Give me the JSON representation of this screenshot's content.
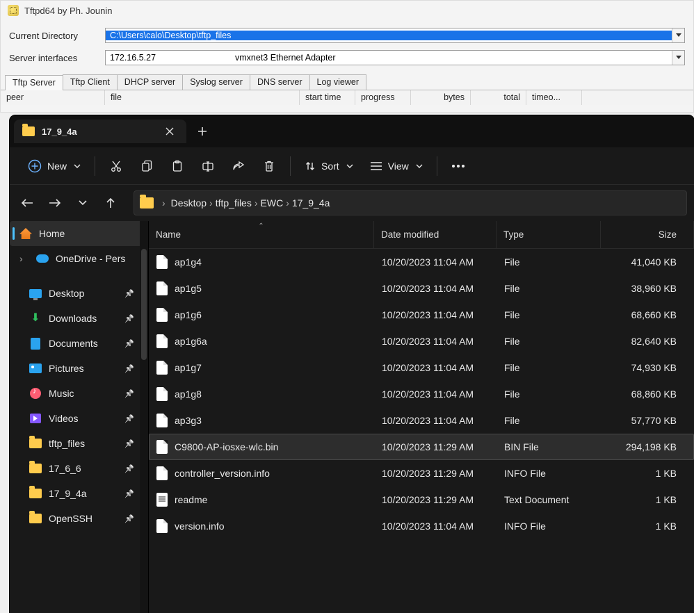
{
  "tftpd": {
    "title": "Tftpd64 by Ph. Jounin",
    "labels": {
      "current_dir": "Current Directory",
      "server_if": "Server interfaces"
    },
    "current_directory": "C:\\Users\\calo\\Desktop\\tftp_files",
    "server_interface_ip": "172.16.5.27",
    "server_interface_adapter": "vmxnet3 Ethernet Adapter",
    "tabs": [
      "Tftp Server",
      "Tftp Client",
      "DHCP server",
      "Syslog server",
      "DNS server",
      "Log viewer"
    ],
    "columns": [
      "peer",
      "file",
      "start time",
      "progress",
      "bytes",
      "total",
      "timeo..."
    ]
  },
  "explorer": {
    "tab_title": "17_9_4a",
    "toolbar": {
      "new": "New",
      "sort": "Sort",
      "view": "View"
    },
    "breadcrumb": [
      "Desktop",
      "tftp_files",
      "EWC",
      "17_9_4a"
    ],
    "sidebar": {
      "home": "Home",
      "onedrive": "OneDrive - Pers",
      "quick": [
        {
          "icon": "desktop",
          "label": "Desktop"
        },
        {
          "icon": "downloads",
          "label": "Downloads"
        },
        {
          "icon": "documents",
          "label": "Documents"
        },
        {
          "icon": "pictures",
          "label": "Pictures"
        },
        {
          "icon": "music",
          "label": "Music"
        },
        {
          "icon": "videos",
          "label": "Videos"
        },
        {
          "icon": "folder",
          "label": "tftp_files"
        },
        {
          "icon": "folder",
          "label": "17_6_6"
        },
        {
          "icon": "folder",
          "label": "17_9_4a"
        },
        {
          "icon": "folder",
          "label": "OpenSSH"
        }
      ]
    },
    "columns": {
      "name": "Name",
      "date": "Date modified",
      "type": "Type",
      "size": "Size"
    },
    "files": [
      {
        "icon": "file",
        "name": "ap1g4",
        "date": "10/20/2023 11:04 AM",
        "type": "File",
        "size": "41,040 KB"
      },
      {
        "icon": "file",
        "name": "ap1g5",
        "date": "10/20/2023 11:04 AM",
        "type": "File",
        "size": "38,960 KB"
      },
      {
        "icon": "file",
        "name": "ap1g6",
        "date": "10/20/2023 11:04 AM",
        "type": "File",
        "size": "68,660 KB"
      },
      {
        "icon": "file",
        "name": "ap1g6a",
        "date": "10/20/2023 11:04 AM",
        "type": "File",
        "size": "82,640 KB"
      },
      {
        "icon": "file",
        "name": "ap1g7",
        "date": "10/20/2023 11:04 AM",
        "type": "File",
        "size": "74,930 KB"
      },
      {
        "icon": "file",
        "name": "ap1g8",
        "date": "10/20/2023 11:04 AM",
        "type": "File",
        "size": "68,860 KB"
      },
      {
        "icon": "file",
        "name": "ap3g3",
        "date": "10/20/2023 11:04 AM",
        "type": "File",
        "size": "57,770 KB"
      },
      {
        "icon": "file",
        "name": "C9800-AP-iosxe-wlc.bin",
        "date": "10/20/2023 11:29 AM",
        "type": "BIN File",
        "size": "294,198 KB",
        "selected": true
      },
      {
        "icon": "file",
        "name": "controller_version.info",
        "date": "10/20/2023 11:29 AM",
        "type": "INFO File",
        "size": "1 KB"
      },
      {
        "icon": "txt",
        "name": "readme",
        "date": "10/20/2023 11:29 AM",
        "type": "Text Document",
        "size": "1 KB"
      },
      {
        "icon": "file",
        "name": "version.info",
        "date": "10/20/2023 11:04 AM",
        "type": "INFO File",
        "size": "1 KB"
      }
    ]
  }
}
